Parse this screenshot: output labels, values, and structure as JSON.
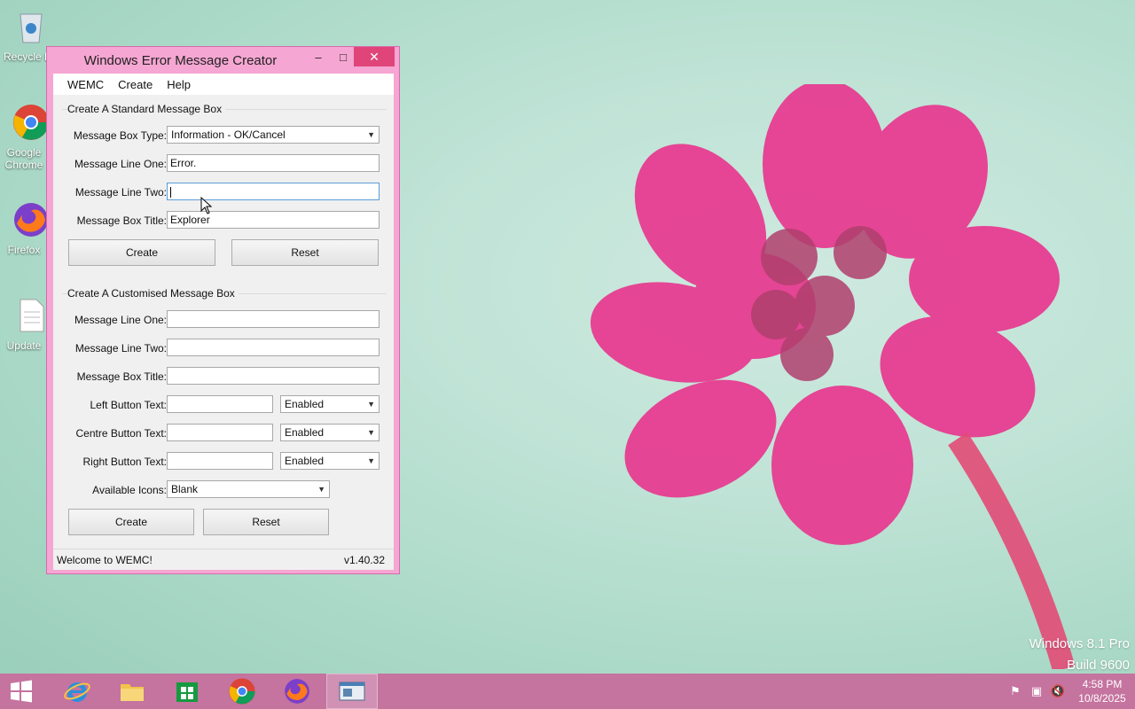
{
  "desktop": {
    "icons": [
      {
        "label": "Recycle Bin",
        "icon": "recycle-bin-icon"
      },
      {
        "label": "Google Chrome",
        "icon": "chrome-icon"
      },
      {
        "label": "Firefox",
        "icon": "firefox-icon"
      },
      {
        "label": "Update",
        "icon": "document-icon"
      }
    ],
    "watermark": {
      "line1": "Windows 8.1 Pro",
      "line2": "Build 9600"
    }
  },
  "window": {
    "title": "Windows Error Message Creator",
    "controls": {
      "minimize": "–",
      "maximize": "□",
      "close": "✕"
    },
    "menu": [
      "WEMC",
      "Create",
      "Help"
    ],
    "standard": {
      "group_title": "Create A Standard Message Box",
      "type_label": "Message Box Type:",
      "type_value": "Information - OK/Cancel",
      "line_one_label": "Message Line One:",
      "line_one_value": "Error.",
      "line_two_label": "Message Line Two:",
      "line_two_value": "",
      "title_label": "Message Box Title:",
      "title_value": "Explorer",
      "create_label": "Create",
      "reset_label": "Reset"
    },
    "custom": {
      "group_title": "Create A Customised Message Box",
      "line_one_label": "Message Line One:",
      "line_two_label": "Message Line Two:",
      "title_label": "Message Box Title:",
      "left_label": "Left Button Text:",
      "left_state": "Enabled",
      "centre_label": "Centre Button Text:",
      "centre_state": "Enabled",
      "right_label": "Right Button Text:",
      "right_state": "Enabled",
      "icons_label": "Available Icons:",
      "icons_value": "Blank",
      "create_label": "Create",
      "reset_label": "Reset"
    },
    "status": {
      "message": "Welcome to WEMC!",
      "version": "v1.40.32"
    }
  },
  "taskbar": {
    "items": [
      "start-icon",
      "internet-explorer-icon",
      "file-explorer-icon",
      "store-icon",
      "chrome-icon",
      "firefox-icon",
      "wemc-icon"
    ],
    "clock": {
      "time": "4:58 PM",
      "date": "10/8/2025"
    }
  },
  "colors": {
    "frame": "#f5a6d2",
    "close": "#e0457a",
    "taskbar": "#c5739f",
    "focus": "#5b9bd5"
  }
}
